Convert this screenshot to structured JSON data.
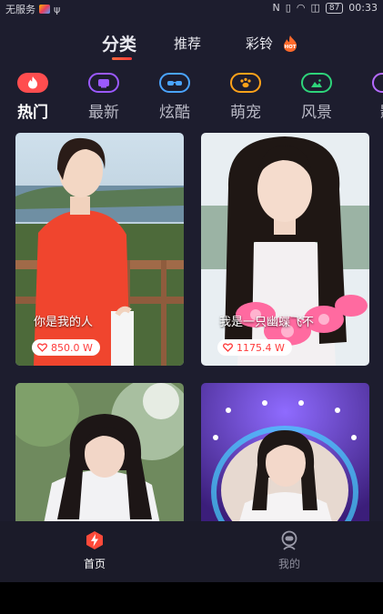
{
  "statusbar": {
    "carrier": "无服务",
    "battery": "87",
    "time": "00:33"
  },
  "top_tabs": [
    {
      "label": "分类",
      "active": true
    },
    {
      "label": "推荐",
      "active": false
    },
    {
      "label": "彩铃",
      "active": false
    }
  ],
  "hot_badge": "HOT",
  "categories": [
    {
      "label": "热门",
      "icon": "flame-icon",
      "color": "#ff4d4f",
      "active": true
    },
    {
      "label": "最新",
      "icon": "tv-icon",
      "color": "#9b59ff",
      "active": false
    },
    {
      "label": "炫酷",
      "icon": "glasses-icon",
      "color": "#4aa4ff",
      "active": false
    },
    {
      "label": "萌宠",
      "icon": "paw-icon",
      "color": "#ffa21a",
      "active": false
    },
    {
      "label": "风景",
      "icon": "mountain-icon",
      "color": "#2ed47a",
      "active": false
    },
    {
      "label": "影",
      "icon": "film-icon",
      "color": "#b56bff",
      "active": false
    }
  ],
  "cards": [
    {
      "caption": "你是我的人",
      "likes": "850.0 W"
    },
    {
      "caption": "我是一只幽蝶飞不",
      "likes": "1175.4 W"
    },
    {
      "caption": "",
      "likes": ""
    },
    {
      "caption": "",
      "likes": ""
    }
  ],
  "bottom_tabs": [
    {
      "label": "首页",
      "icon": "home-icon",
      "active": true
    },
    {
      "label": "我的",
      "icon": "profile-icon",
      "active": false
    }
  ],
  "colors": {
    "background": "#1d1d2e",
    "accent": "#ff3a3a",
    "active_tab_text": "#ffffff",
    "inactive_text": "#b9b9c5"
  }
}
